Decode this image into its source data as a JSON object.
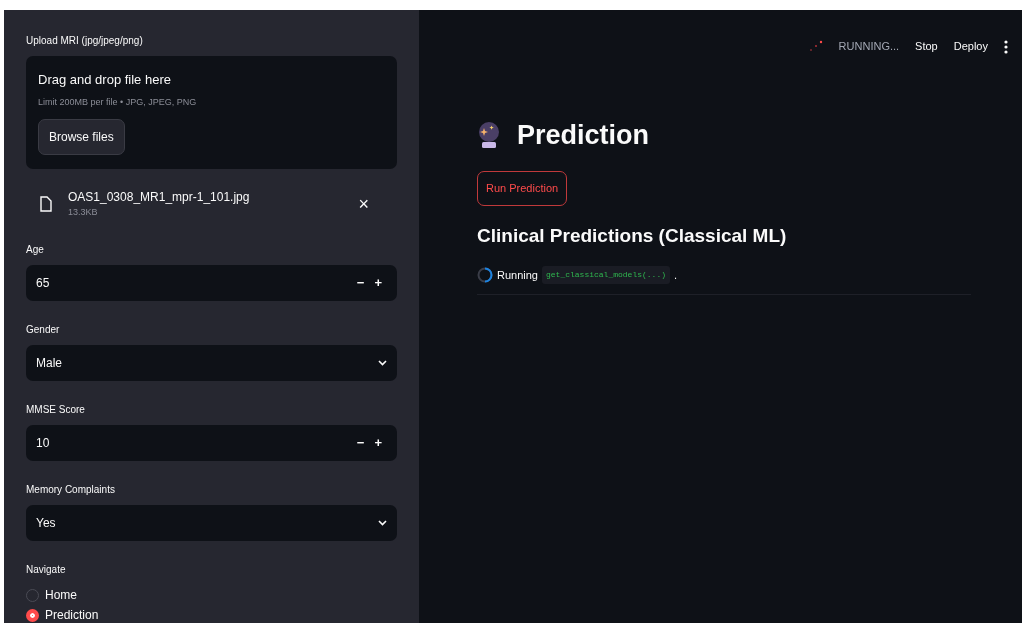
{
  "sidebar": {
    "uploader": {
      "label": "Upload MRI (jpg/jpeg/png)",
      "drop_title": "Drag and drop file here",
      "drop_hint": "Limit 200MB per file • JPG, JPEG, PNG",
      "browse_button": "Browse files",
      "file": {
        "name": "OAS1_0308_MR1_mpr-1_101.jpg",
        "size": "13.3KB",
        "remove": "×"
      }
    },
    "fields": [
      {
        "kind": "number",
        "label": "Age",
        "value": "65",
        "minus": "−",
        "plus": "+"
      },
      {
        "kind": "select",
        "label": "Gender",
        "value": "Male"
      },
      {
        "kind": "number",
        "label": "MMSE Score",
        "value": "10",
        "minus": "−",
        "plus": "+"
      },
      {
        "kind": "select",
        "label": "Memory Complaints",
        "value": "Yes"
      }
    ],
    "navigate": {
      "label": "Navigate",
      "options": [
        {
          "label": "Home",
          "selected": false
        },
        {
          "label": "Prediction",
          "selected": true
        }
      ]
    }
  },
  "header": {
    "status": "RUNNING...",
    "stop": "Stop",
    "deploy": "Deploy"
  },
  "main": {
    "title": "Prediction",
    "run_button": "Run Prediction",
    "section_title": "Clinical Predictions (Classical ML)",
    "running_label": "Running",
    "running_code": "get_classical_models(...)",
    "running_suffix": "."
  }
}
